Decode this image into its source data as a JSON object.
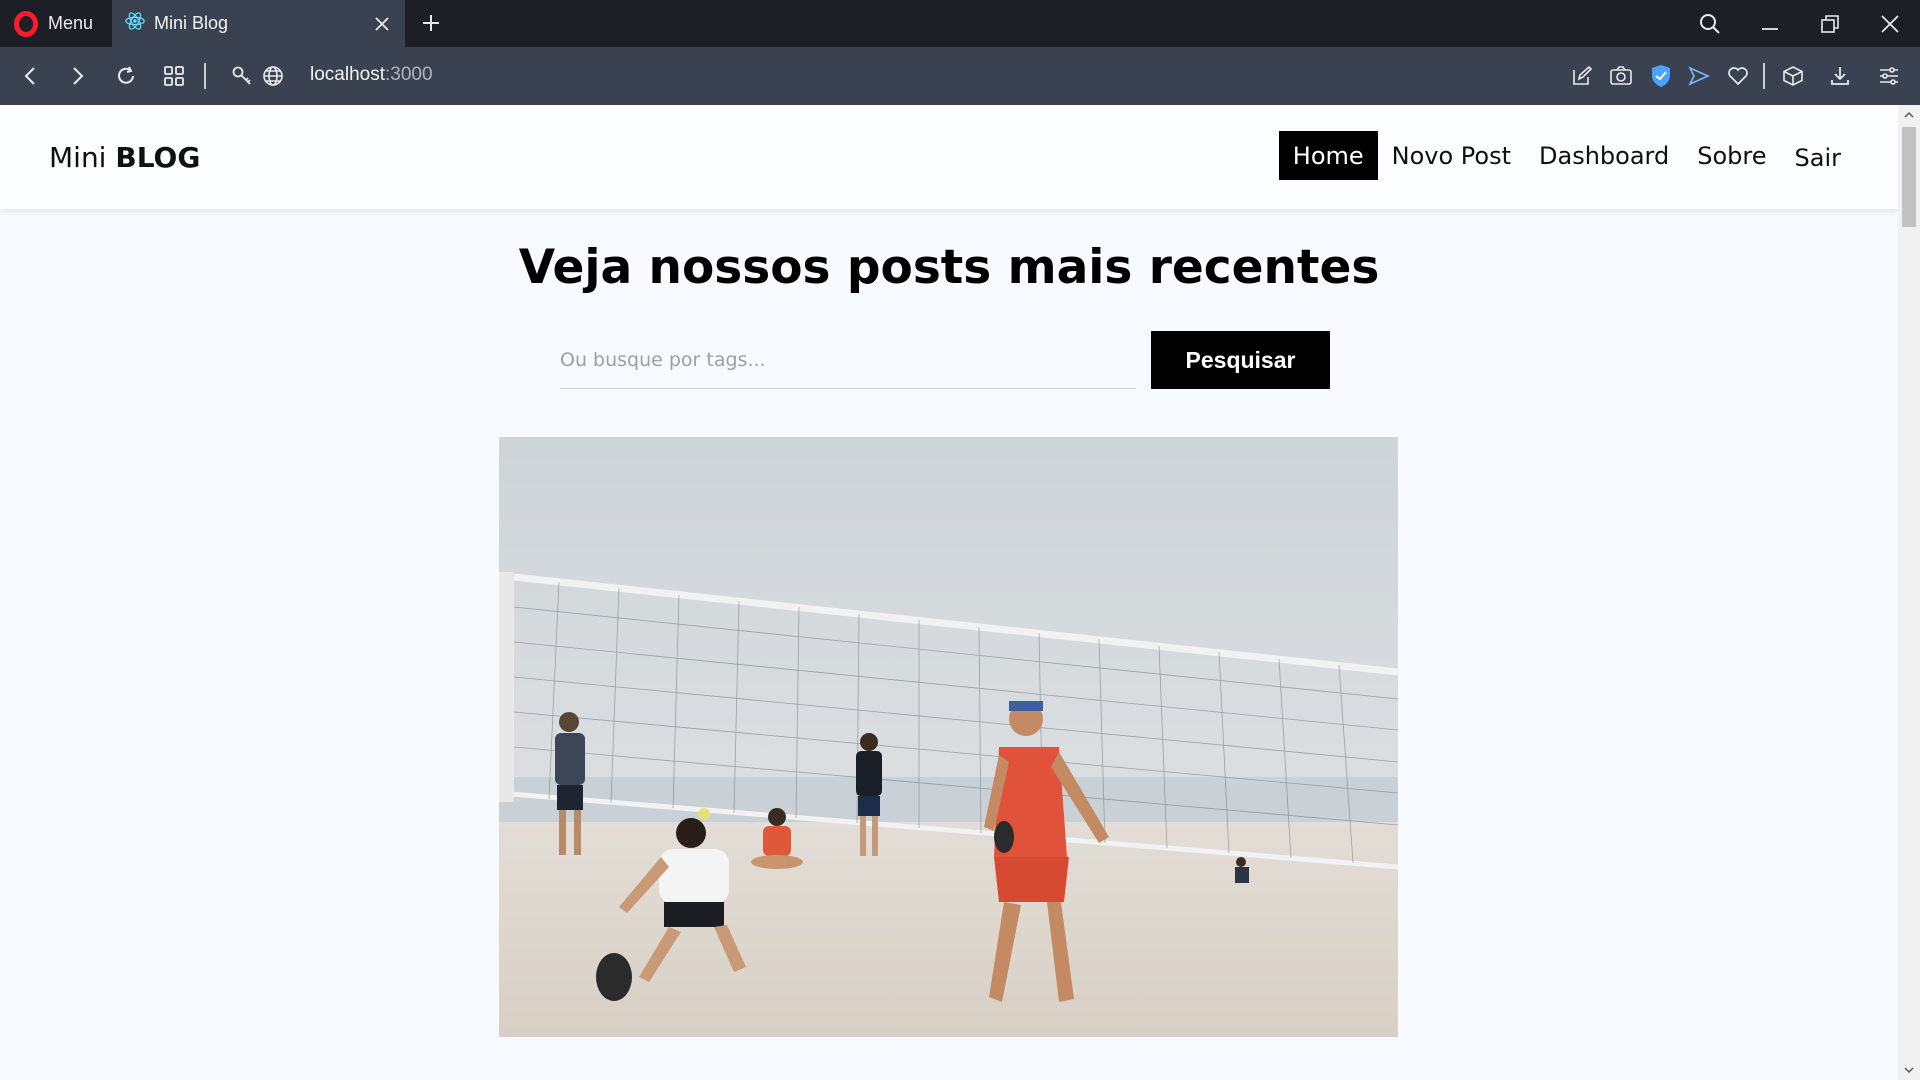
{
  "browser": {
    "menu_label": "Menu",
    "tab_title": "Mini Blog",
    "url_host": "localhost",
    "url_port": ":3000"
  },
  "site": {
    "brand_light": "Mini",
    "brand_bold": "BLOG",
    "nav": {
      "home": "Home",
      "new_post": "Novo Post",
      "dashboard": "Dashboard",
      "about": "Sobre",
      "logout": "Sair"
    }
  },
  "home": {
    "heading": "Veja nossos posts mais recentes",
    "search_placeholder": "Ou busque por tags...",
    "search_button": "Pesquisar"
  },
  "icons": {
    "tab_favicon": "react-atom-icon",
    "colors": {
      "opera_red": "#ff1b2d",
      "react_blue": "#61dafb",
      "shield_blue": "#4aa3ff"
    }
  }
}
